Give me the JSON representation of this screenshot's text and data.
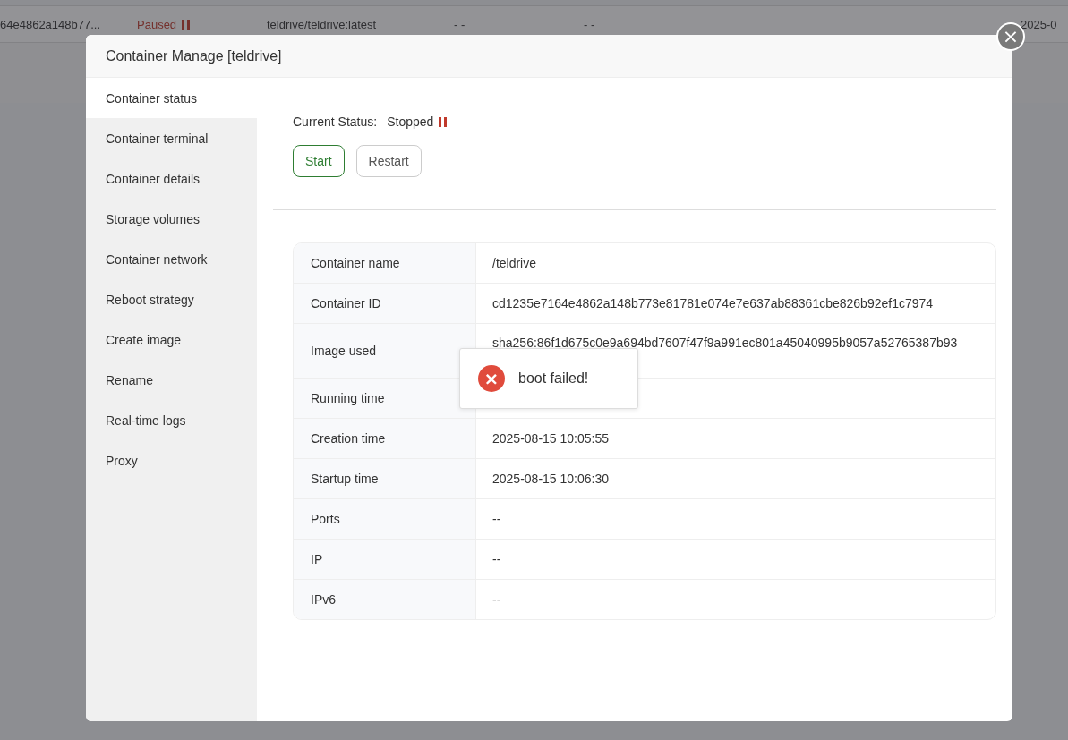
{
  "background_row": {
    "cells": [
      {
        "kind": "text",
        "text": "64e4862a148b77..."
      },
      {
        "kind": "status",
        "text": "Paused"
      },
      {
        "kind": "text",
        "text": "teldrive/teldrive:latest"
      },
      {
        "kind": "text",
        "text": "- -"
      },
      {
        "kind": "text",
        "text": "- -"
      },
      {
        "kind": "text",
        "text": "2025-0"
      }
    ]
  },
  "modal": {
    "title": "Container Manage [teldrive]",
    "close": "×",
    "sidebar": {
      "items": [
        {
          "label": "Container status",
          "selected": true
        },
        {
          "label": "Container terminal",
          "selected": false
        },
        {
          "label": "Container details",
          "selected": false
        },
        {
          "label": "Storage volumes",
          "selected": false
        },
        {
          "label": "Container network",
          "selected": false
        },
        {
          "label": "Reboot strategy",
          "selected": false
        },
        {
          "label": "Create image",
          "selected": false
        },
        {
          "label": "Rename",
          "selected": false
        },
        {
          "label": "Real-time logs",
          "selected": false
        },
        {
          "label": "Proxy",
          "selected": false
        }
      ]
    },
    "status": {
      "label": "Current Status:",
      "value": "Stopped"
    },
    "buttons": [
      {
        "label": "Start",
        "kind": "primary"
      },
      {
        "label": "Restart",
        "kind": "default"
      }
    ],
    "details": [
      {
        "label": "Container name",
        "value": "/teldrive"
      },
      {
        "label": "Container ID",
        "value": "cd1235e7164e4862a148b773e81781e074e7e637ab88361cbe826b92ef1c7974"
      },
      {
        "label": "Image used",
        "value": "sha256:86f1d675c0e9a694bd7607f47f9a991ec801a45040995b9057a52765387b93",
        "tall": true
      },
      {
        "label": "Running time"
      },
      {
        "label": "Creation time",
        "value": "2025-08-15 10:05:55"
      },
      {
        "label": "Startup time",
        "value": "2025-08-15 10:06:30"
      },
      {
        "label": "Ports",
        "value": "--"
      },
      {
        "label": "IP",
        "value": "--"
      },
      {
        "label": "IPv6",
        "value": "--"
      }
    ],
    "toast": {
      "kind": "error",
      "message": "boot failed!",
      "icon": "×"
    }
  }
}
